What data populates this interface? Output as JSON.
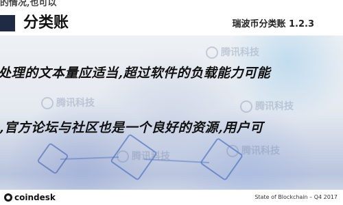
{
  "header": {
    "top_fragment": "的情况,也可以",
    "category_title": "分类账",
    "page_title": "瑞波币分类账 1.2.3"
  },
  "body_lines": [
    "处理的文本量应适当,超过软件的负载能力可能",
    ",官方论坛与社区也是一个良好的资源,用户可"
  ],
  "watermark_text": "腾讯科技",
  "footer": {
    "logo_text": "coindesk",
    "caption": "State of Blockchain – Q4 2017"
  }
}
